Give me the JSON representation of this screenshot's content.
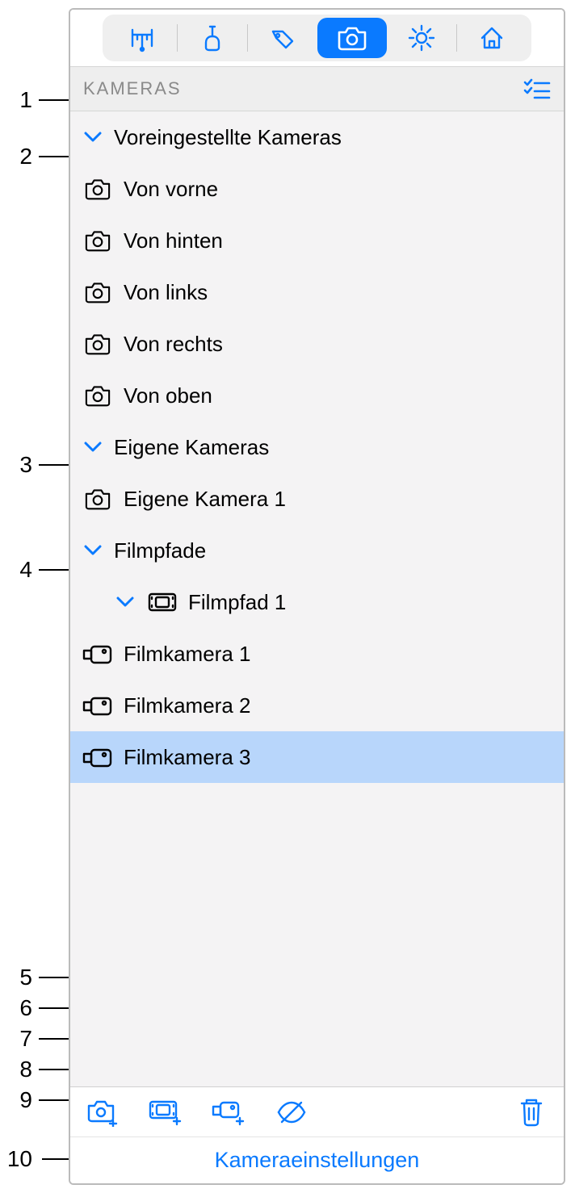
{
  "header": {
    "title": "KAMERAS"
  },
  "groups": {
    "preset": {
      "label": "Voreingestellte Kameras",
      "items": [
        "Von vorne",
        "Von hinten",
        "Von links",
        "Von rechts",
        "Von oben"
      ]
    },
    "custom": {
      "label": "Eigene Kameras",
      "items": [
        "Eigene Kamera 1"
      ]
    },
    "paths": {
      "label": "Filmpfade",
      "path1": {
        "label": "Filmpfad 1",
        "items": [
          "Filmkamera 1",
          "Filmkamera 2",
          "Filmkamera 3"
        ]
      }
    }
  },
  "footer": {
    "link": "Kameraeinstellungen"
  },
  "callouts": {
    "1": "1",
    "2": "2",
    "3": "3",
    "4": "4",
    "5": "5",
    "6": "6",
    "7": "7",
    "8": "8",
    "9": "9",
    "10": "10"
  }
}
